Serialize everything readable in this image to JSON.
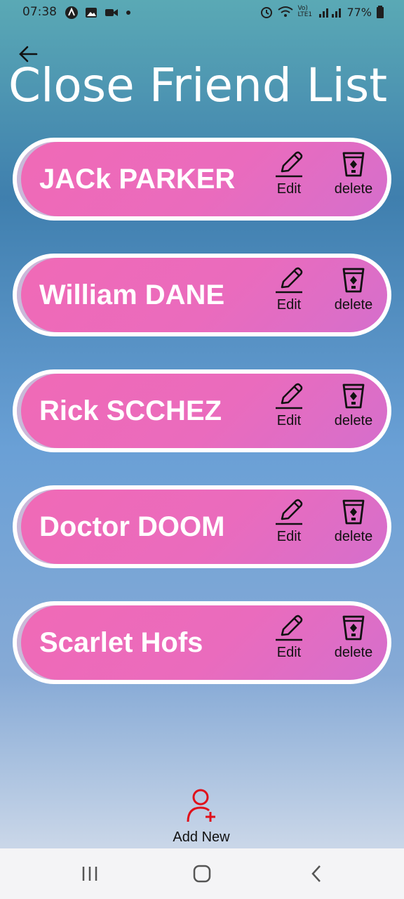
{
  "status_bar": {
    "time": "07:38",
    "battery": "77%",
    "network": "Vo) LTE1"
  },
  "header": {
    "title": "Close Friend List"
  },
  "friends": [
    {
      "name": "JACk PARKER"
    },
    {
      "name": "William DANE"
    },
    {
      "name": "Rick SCCHEZ"
    },
    {
      "name": "Doctor DOOM"
    },
    {
      "name": "Scarlet Hofs"
    }
  ],
  "actions": {
    "edit_label": "Edit",
    "delete_label": "delete"
  },
  "footer": {
    "add_new_label": "Add New"
  },
  "colors": {
    "card_pink": "#f06ab6",
    "card_border": "#ffffff",
    "add_icon_red": "#e0101a"
  },
  "icons": [
    "back-arrow-icon",
    "edit-pencil-icon",
    "trash-icon",
    "add-user-icon",
    "recents-icon",
    "home-icon",
    "nav-back-icon"
  ]
}
